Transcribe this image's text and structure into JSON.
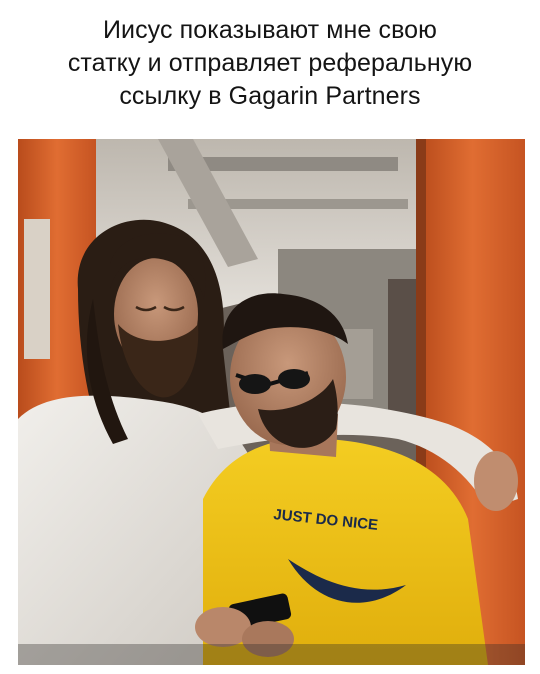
{
  "caption": {
    "lines": [
      "Иисус показывают мне свою",
      "статку и отправляет реферальную",
      "ссылку в Gagarin Partners"
    ]
  },
  "photo": {
    "shirt_print": "JUST DO NICE",
    "colors": {
      "orange_wall": "#d8622a",
      "shirt_yellow": "#f1c316",
      "white_robe": "#e9e6e1",
      "hair_dark": "#2a1d14",
      "skin": "#b78567",
      "ceiling": "#cfcac3"
    }
  }
}
